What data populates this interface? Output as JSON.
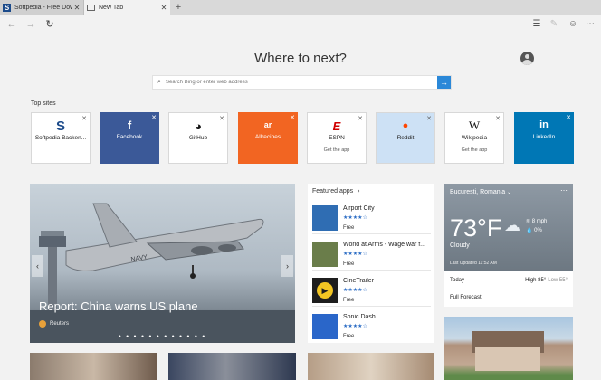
{
  "tabs": [
    {
      "label": "Softpedia - Free Downloads En",
      "icon": "softpedia-favicon",
      "close": "✕"
    },
    {
      "label": "New Tab",
      "icon": "newtab-icon",
      "close": "✕"
    }
  ],
  "new_tab_button": "+",
  "nav": {
    "back": "←",
    "forward": "→",
    "refresh": "↻"
  },
  "toolbar_icons": [
    "reading-view-icon",
    "web-note-icon",
    "feedback-smiley-icon",
    "more-icon"
  ],
  "toolbar_glyphs": [
    "☰",
    "✎",
    "☺",
    "⋯"
  ],
  "heading": "Where to next?",
  "search": {
    "placeholder": "Search Bing or enter web address",
    "go": "→"
  },
  "top_sites_label": "Top sites",
  "top_sites": [
    {
      "name": "Softpedia Backen...",
      "logo": "S",
      "sub": "",
      "bg": "#ffffff",
      "fg": "#1b4a8a"
    },
    {
      "name": "Facebook",
      "logo": "f",
      "sub": "",
      "bg": "#3b5998",
      "fg": "#ffffff"
    },
    {
      "name": "GitHub",
      "logo": "◕",
      "sub": "",
      "bg": "#ffffff",
      "fg": "#111111"
    },
    {
      "name": "Allrecipes",
      "logo": "ar",
      "sub": "",
      "bg": "#f26522",
      "fg": "#ffffff"
    },
    {
      "name": "ESPN",
      "logo": "E",
      "sub": "Get the app",
      "bg": "#ffffff",
      "fg": "#d00000"
    },
    {
      "name": "Reddit",
      "logo": "●",
      "sub": "",
      "bg": "#cde1f5",
      "fg": "#ff4500"
    },
    {
      "name": "Wikipedia",
      "logo": "W",
      "sub": "Get the app",
      "bg": "#ffffff",
      "fg": "#111111"
    },
    {
      "name": "LinkedIn",
      "logo": "in",
      "sub": "",
      "bg": "#0077b5",
      "fg": "#ffffff"
    }
  ],
  "tile_close": "✕",
  "hero": {
    "title": "Report: China warns US plane",
    "source": "Reuters",
    "prev": "‹",
    "next": "›",
    "dots": "● ● ● ● ● ● ● ● ● ● ● ●"
  },
  "featured": {
    "header": "Featured apps",
    "chevron": "›",
    "apps": [
      {
        "name": "Airport City",
        "stars": "★★★★☆",
        "price": "Free",
        "color": "#2f6db3"
      },
      {
        "name": "World at Arms - Wage war f...",
        "stars": "★★★★☆",
        "price": "Free",
        "color": "#6a7d4a"
      },
      {
        "name": "CineTrailer",
        "stars": "★★★★☆",
        "price": "Free",
        "color": "#1e1e1e"
      },
      {
        "name": "Sonic Dash",
        "stars": "★★★★☆",
        "price": "Free",
        "color": "#2a66c9"
      }
    ]
  },
  "weather": {
    "location": "Bucuresti, Romania",
    "chevron": "⌄",
    "more": "⋯",
    "temp": "73°F",
    "condition": "Cloudy",
    "wind": "≋ 8 mph",
    "precip": "💧 0%",
    "cloud_glyph": "☁",
    "updated": "Last Updated 11:52 AM",
    "day": "Today",
    "high": "High 85°",
    "low": "Low 55°",
    "forecast_link": "Full Forecast"
  }
}
